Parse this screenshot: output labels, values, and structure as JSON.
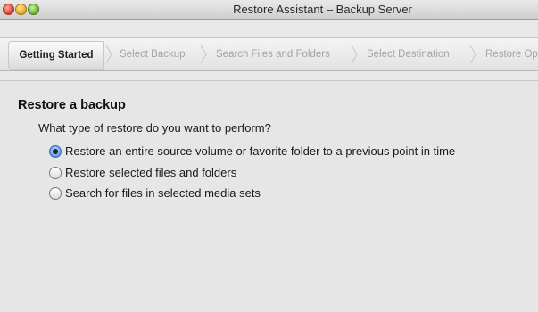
{
  "window": {
    "title": "Restore Assistant – Backup Server"
  },
  "steps": [
    {
      "label": "Getting Started",
      "active": true
    },
    {
      "label": "Select Backup",
      "active": false
    },
    {
      "label": "Search Files and Folders",
      "active": false
    },
    {
      "label": "Select Destination",
      "active": false
    },
    {
      "label": "Restore Op",
      "active": false
    }
  ],
  "main": {
    "heading": "Restore a backup",
    "question": "What type of restore do you want to perform?",
    "options": [
      {
        "label": "Restore an entire source volume or favorite folder to a previous point in time",
        "selected": true
      },
      {
        "label": "Restore selected files and folders",
        "selected": false
      },
      {
        "label": "Search for files in selected media sets",
        "selected": false
      }
    ]
  },
  "colors": {
    "accent": "#3c78c8",
    "inactive_step": "#a3a3a3"
  }
}
